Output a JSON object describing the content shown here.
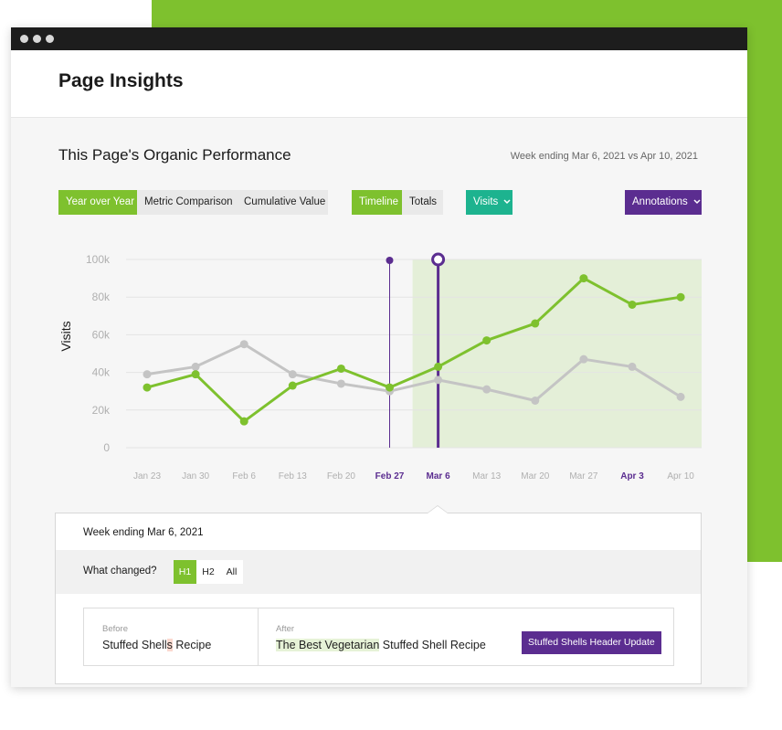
{
  "page": {
    "title": "Page Insights"
  },
  "section": {
    "title": "This Page's Organic Performance",
    "week_compare": "Week ending Mar 6, 2021 vs Apr 10, 2021"
  },
  "controls": {
    "view_tabs": [
      "Year over Year",
      "Metric Comparison",
      "Cumulative Value"
    ],
    "mode_tabs": [
      "Timeline",
      "Totals"
    ],
    "metric_dropdown": "Visits",
    "annotations_dropdown": "Annotations"
  },
  "colors": {
    "brand_green": "#7ec12e",
    "teal": "#1db38f",
    "purple": "#5b2d90",
    "grey_series": "#c4c4c4",
    "highlight_region": "#e4efd8"
  },
  "chart_data": {
    "type": "line",
    "ylabel": "Visits",
    "xlabel": "",
    "ylim": [
      0,
      100000
    ],
    "y_ticks": [
      "100k",
      "80k",
      "60k",
      "40k",
      "20k",
      "0"
    ],
    "y_tick_values": [
      100000,
      80000,
      60000,
      40000,
      20000,
      0
    ],
    "categories": [
      "Jan 23",
      "Jan 30",
      "Feb 6",
      "Feb 13",
      "Feb 20",
      "Feb 27",
      "Mar 6",
      "Mar 13",
      "Mar 20",
      "Mar 27",
      "Apr 3",
      "Apr 10"
    ],
    "highlighted_categories": [
      "Feb 27",
      "Mar 6",
      "Apr 3"
    ],
    "series": [
      {
        "color": "#c4c4c4",
        "values": [
          39000,
          43000,
          55000,
          39000,
          34000,
          30000,
          36000,
          31000,
          25000,
          47000,
          43000,
          27000
        ]
      },
      {
        "color": "#7ec12e",
        "values": [
          32000,
          39000,
          14000,
          33000,
          42000,
          32000,
          43000,
          57000,
          66000,
          90000,
          76000,
          80000
        ]
      }
    ],
    "highlight_range": [
      "Mar 6",
      "Apr 10"
    ],
    "markers": [
      {
        "category": "Feb 27",
        "style": "thin-dot"
      },
      {
        "category": "Mar 6",
        "style": "thick-ring"
      }
    ],
    "grid": true
  },
  "details": {
    "week": "Week ending Mar 6, 2021",
    "what_changed_label": "What changed?",
    "heading_tabs": [
      "H1",
      "H2",
      "All"
    ],
    "before_label": "Before",
    "before_text": "Stuffed Shells Recipe",
    "before_parts": [
      "Stuffed Shell",
      "s",
      " Recipe"
    ],
    "after_label": "After",
    "after_text": "The Best Vegetarian Stuffed Shell Recipe",
    "after_parts": [
      "The Best Vegetarian",
      " Stuffed Shell Recipe"
    ],
    "annotation_button": "Stuffed Shells Header Update"
  }
}
